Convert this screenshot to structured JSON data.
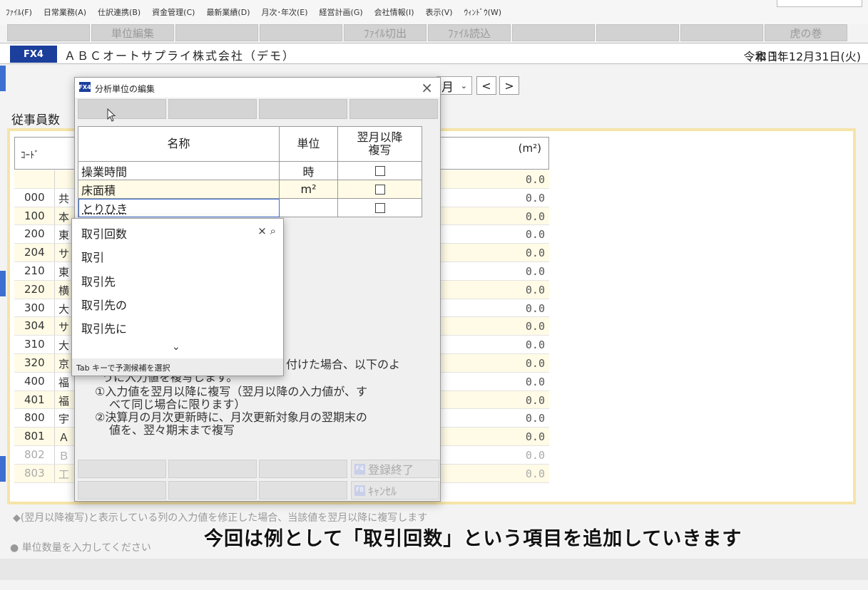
{
  "menu": {
    "items": [
      "ﾌｧｲﾙ(F)",
      "日常業務(A)",
      "仕訳連携(B)",
      "資金管理(C)",
      "最新業績(D)",
      "月次･年次(E)",
      "経営計画(G)",
      "会社情報(I)",
      "表示(V)",
      "ｳｨﾝﾄﾞｳ(W)"
    ]
  },
  "fnbar": {
    "labels": [
      "",
      "単位編集",
      "",
      "",
      "ﾌｧｲﾙ切出",
      "ﾌｧｲﾙ読込",
      "",
      "",
      "",
      "虎の巻"
    ]
  },
  "header": {
    "badge": "FX4",
    "company": "ＡＢＣオートサプライ株式会社（デモ）",
    "today_label": "本日：",
    "today_date": "令和 1年12月31日(火)"
  },
  "period": {
    "month_label": "月",
    "prev": "<",
    "next": ">"
  },
  "section": {
    "title": "従事員数"
  },
  "grid": {
    "code_header": "ｺｰﾄﾞ",
    "unit_header": "(m²)",
    "rows": [
      {
        "code": "",
        "name": "",
        "value": "0.0"
      },
      {
        "code": "000",
        "name": "共",
        "value": "0.0"
      },
      {
        "code": "100",
        "name": "本",
        "value": "0.0"
      },
      {
        "code": "200",
        "name": "東",
        "value": "0.0"
      },
      {
        "code": "204",
        "name": "サ",
        "value": "0.0"
      },
      {
        "code": "210",
        "name": "東",
        "value": "0.0"
      },
      {
        "code": "220",
        "name": "横",
        "value": "0.0"
      },
      {
        "code": "300",
        "name": "大",
        "value": "0.0"
      },
      {
        "code": "304",
        "name": "サ",
        "value": "0.0"
      },
      {
        "code": "310",
        "name": "大",
        "value": "0.0"
      },
      {
        "code": "320",
        "name": "京",
        "value": "0.0"
      },
      {
        "code": "400",
        "name": "福",
        "value": "0.0"
      },
      {
        "code": "401",
        "name": "福",
        "value": "0.0"
      },
      {
        "code": "800",
        "name": "宇",
        "value": "0.0"
      },
      {
        "code": "801",
        "name": "Ａ",
        "value": "0.0"
      },
      {
        "code": "802",
        "name": "Ｂ",
        "value": "0.0"
      },
      {
        "code": "803",
        "name": "工",
        "value": "0.0"
      }
    ]
  },
  "help": {
    "line1": "◆(翌月以降複写)と表示している列の入力値を修正した場合、当該値を翌月以降に複写します",
    "line2": "● 単位数量を入力してください"
  },
  "dialog": {
    "icon": "FX4",
    "title": "分析単位の編集",
    "close": "×",
    "headers": {
      "name": "名称",
      "unit": "単位",
      "copy": "翌月以降\n複写"
    },
    "rows": [
      {
        "name": "操業時間",
        "unit": "時"
      },
      {
        "name": "床面積",
        "unit": "m²"
      }
    ],
    "input_value": "とりひき",
    "info_head": "付けた場合、以下のよ",
    "info_sub": "うに入力値を複写します。",
    "info_1": "①入力値を翌月以降に複写（翌月以降の入力値が、す",
    "info_1b": "べて同じ場合に限ります）",
    "info_2": "②決算月の月次更新時に、月次更新対象月の翌期末の",
    "info_2b": "値を、翌々期末まで複写",
    "register_key": "F4",
    "register_label": "登録終了",
    "cancel_key": "F8",
    "cancel_label": "ｷｬﾝｾﾙ"
  },
  "ime": {
    "suggestions": [
      "取引回数",
      "取引",
      "取引先",
      "取引先の",
      "取引先に"
    ],
    "controls": "× ⌕",
    "more": "⌄",
    "hint": "Tab キーで予測候補を選択"
  },
  "subtitle": "今回は例として「取引回数」という項目を追加していきます"
}
